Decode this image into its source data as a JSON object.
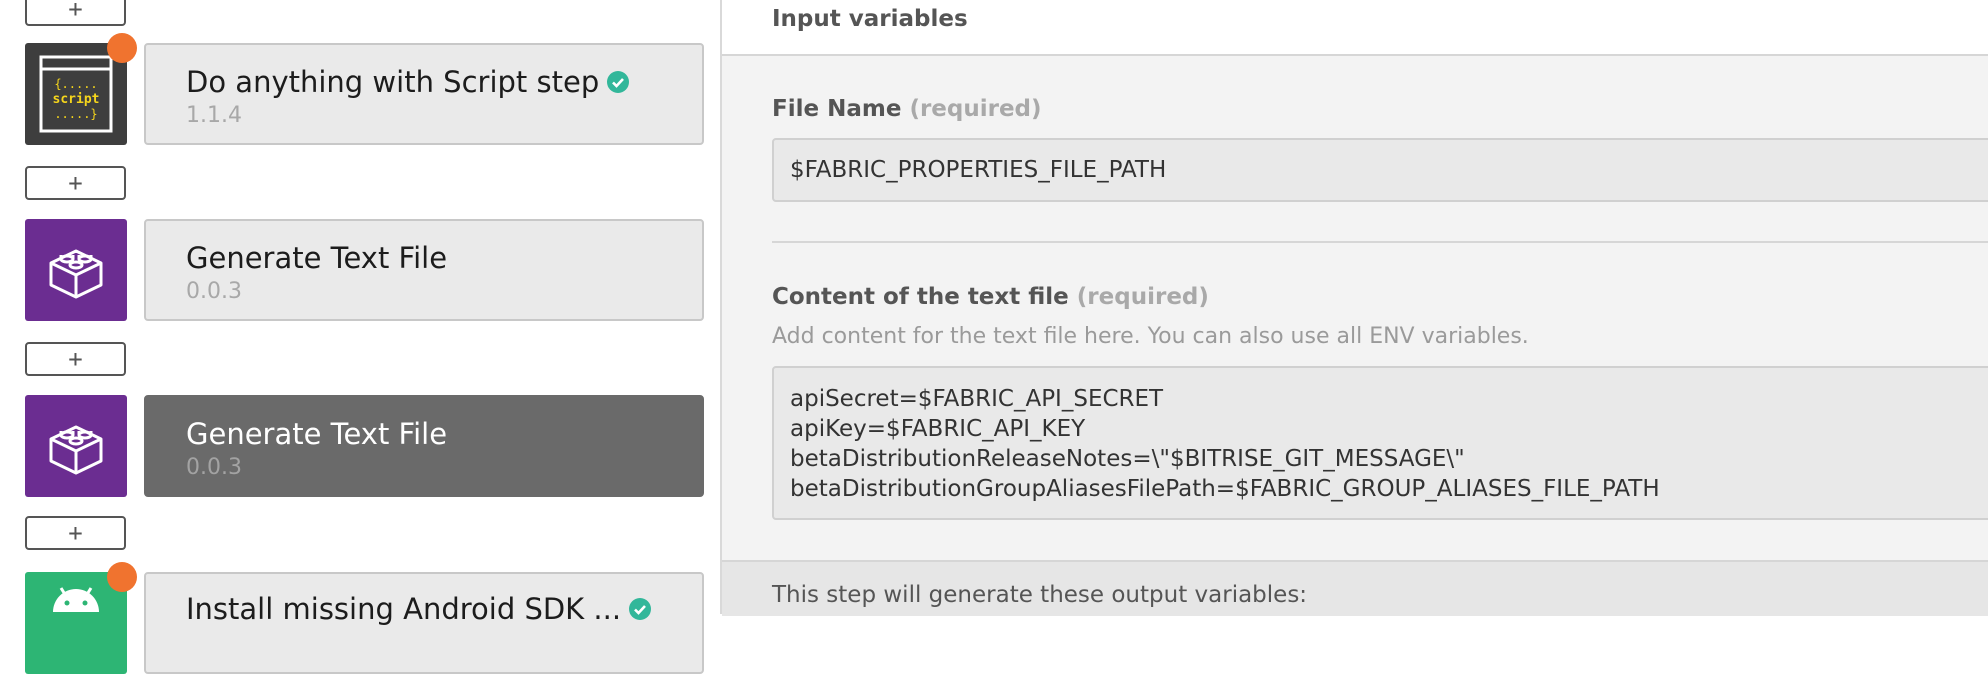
{
  "workflow": {
    "add_label": "+",
    "steps": [
      {
        "title": "Do anything with Script step",
        "version": "1.1.4",
        "icon": "script-step-icon",
        "verified": true,
        "update_available": true
      },
      {
        "title": "Generate Text File",
        "version": "0.0.3",
        "icon": "lego-brick-icon",
        "verified": false,
        "update_available": false
      },
      {
        "title": "Generate Text File",
        "version": "0.0.3",
        "icon": "lego-brick-icon",
        "verified": false,
        "update_available": false,
        "selected": true
      },
      {
        "title": "Install missing Android SDK ...",
        "version": "",
        "icon": "android-icon",
        "verified": true,
        "update_available": true
      }
    ],
    "script_icon_lines": [
      "{.....",
      "script",
      ".....}"
    ]
  },
  "inputs": {
    "section_title": "Input variables",
    "file_name": {
      "label": "File Name",
      "required": "(required)",
      "value": "$FABRIC_PROPERTIES_FILE_PATH"
    },
    "content": {
      "label": "Content of the text file",
      "required": "(required)",
      "description": "Add content for the text file here. You can also use all ENV variables.",
      "lines": [
        "apiSecret=$FABRIC_API_SECRET",
        "apiKey=$FABRIC_API_KEY",
        "betaDistributionReleaseNotes=\\\"$BITRISE_GIT_MESSAGE\\\"",
        "betaDistributionGroupAliasesFilePath=$FABRIC_GROUP_ALIASES_FILE_PATH"
      ]
    }
  },
  "outputs": {
    "text": "This step will generate these output variables:"
  },
  "colors": {
    "accent_orange": "#f0732f",
    "step_purple": "#6b2d91",
    "android_green": "#2db574",
    "verified_teal": "#32b79a",
    "selected_card": "#6a6a6a"
  }
}
